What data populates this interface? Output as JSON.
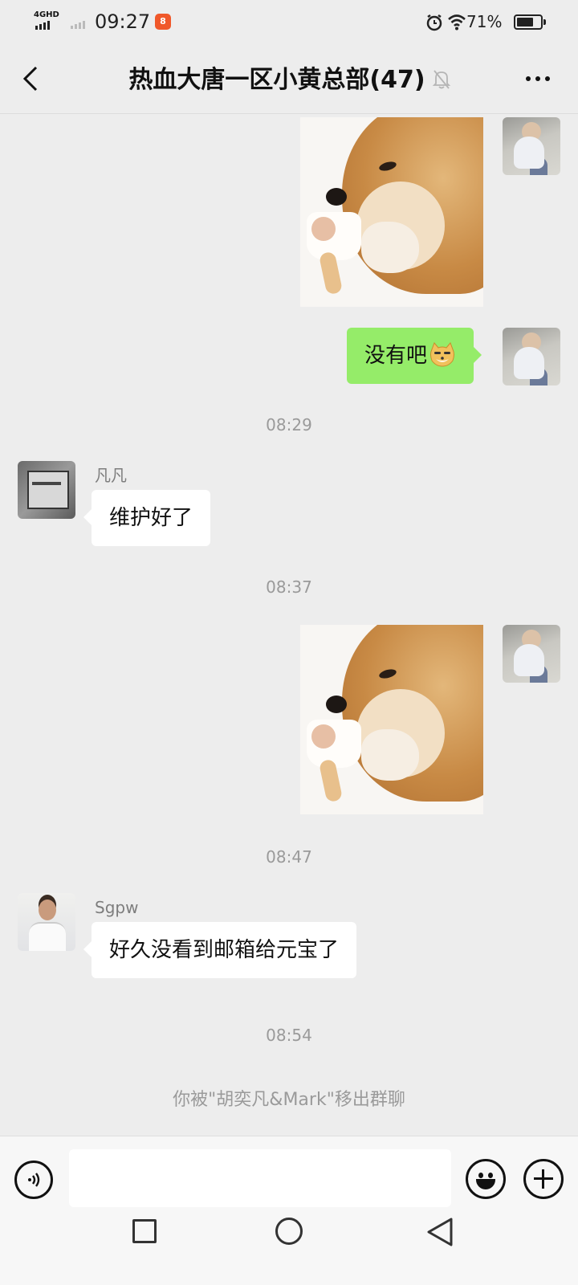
{
  "status_bar": {
    "network": "4GHD",
    "time": "09:27",
    "app_badge": "8",
    "battery_percent": "71%",
    "battery_level": 0.71
  },
  "header": {
    "title": "热血大唐一区小黄总部(47)"
  },
  "messages": [
    {
      "type": "sticker",
      "side": "right",
      "sticker": "doge-ice-cream"
    },
    {
      "type": "text",
      "side": "right",
      "text": "没有吧",
      "emoji": "doge-emoji"
    },
    {
      "type": "timestamp",
      "text": "08:29"
    },
    {
      "type": "text",
      "side": "left",
      "sender": "凡凡",
      "text": "维护好了"
    },
    {
      "type": "timestamp",
      "text": "08:37"
    },
    {
      "type": "sticker",
      "side": "right",
      "sticker": "doge-ice-cream"
    },
    {
      "type": "timestamp",
      "text": "08:47"
    },
    {
      "type": "text",
      "side": "left",
      "sender": "Sgpw",
      "text": "好久没看到邮箱给元宝了"
    },
    {
      "type": "timestamp",
      "text": "08:54"
    },
    {
      "type": "system",
      "text": "你被\"胡奕凡&Mark\"移出群聊"
    }
  ],
  "input_bar": {
    "value": "",
    "icons": [
      "voice-icon",
      "emoji-icon",
      "plus-icon"
    ]
  },
  "nav_bar": {
    "icons": [
      "recent-apps-icon",
      "home-icon",
      "back-icon"
    ]
  },
  "colors": {
    "background": "#ededed",
    "outgoing_bubble": "#95ec69",
    "incoming_bubble": "#ffffff"
  }
}
